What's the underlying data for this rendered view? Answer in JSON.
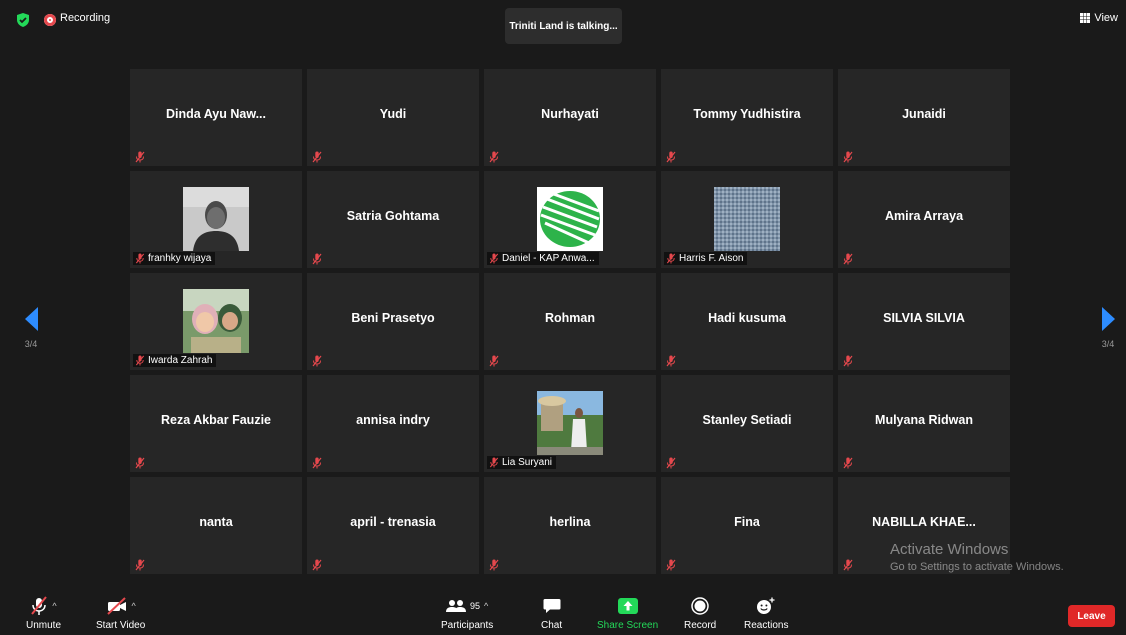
{
  "top": {
    "recording_label": "Recording",
    "talking": "Triniti Land is talking...",
    "view_label": "View"
  },
  "nav": {
    "page": "3/4"
  },
  "tiles": [
    {
      "name": "Dinda Ayu Naw...",
      "video": false
    },
    {
      "name": "Yudi",
      "video": false
    },
    {
      "name": "Nurhayati",
      "video": false
    },
    {
      "name": "Tommy Yudhistira",
      "video": false
    },
    {
      "name": "Junaidi",
      "video": false
    },
    {
      "name": "franhky wijaya",
      "video": true,
      "photo": "person-photo"
    },
    {
      "name": "Satria Gohtama",
      "video": false
    },
    {
      "name": "Daniel - KAP Anwa...",
      "video": true,
      "photo": "green-logo"
    },
    {
      "name": "Harris F. Aison",
      "video": true,
      "photo": "fabric-texture"
    },
    {
      "name": "Amira Arraya",
      "video": false
    },
    {
      "name": "Iwarda Zahrah",
      "video": true,
      "photo": "selfie-photo"
    },
    {
      "name": "Beni Prasetyo",
      "video": false
    },
    {
      "name": "Rohman",
      "video": false
    },
    {
      "name": "Hadi kusuma",
      "video": false
    },
    {
      "name": "SILVIA SILVIA",
      "video": false
    },
    {
      "name": "Reza Akbar Fauzie",
      "video": false
    },
    {
      "name": "annisa indry",
      "video": false
    },
    {
      "name": "Lia Suryani",
      "video": true,
      "photo": "outdoor-photo"
    },
    {
      "name": "Stanley Setiadi",
      "video": false
    },
    {
      "name": "Mulyana Ridwan",
      "video": false
    },
    {
      "name": "nanta",
      "video": false
    },
    {
      "name": "april - trenasia",
      "video": false
    },
    {
      "name": "herlina",
      "video": false
    },
    {
      "name": "Fina",
      "video": false
    },
    {
      "name": "NABILLA KHAE...",
      "video": false
    }
  ],
  "toolbar": {
    "unmute": "Unmute",
    "start_video": "Start Video",
    "participants_count": "95",
    "participants": "Participants",
    "chat": "Chat",
    "share_screen": "Share Screen",
    "record": "Record",
    "reactions": "Reactions",
    "leave": "Leave"
  },
  "watermark": {
    "line1": "Activate Windows",
    "line2": "Go to Settings to activate Windows."
  },
  "colors": {
    "accent": "#2d8cff",
    "share_green": "#23d959",
    "leave_red": "#e02828",
    "mute_red": "#e5484d"
  }
}
